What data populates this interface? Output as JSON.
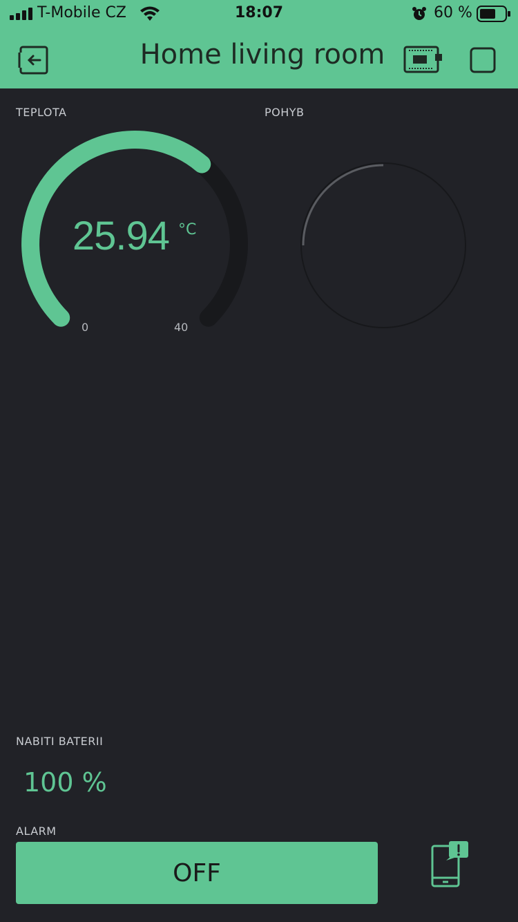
{
  "status_bar": {
    "carrier": "T-Mobile CZ",
    "time": "18:07",
    "battery_percent": "60 %",
    "icons": [
      "signal-icon",
      "wifi-icon",
      "alarm-clock-icon",
      "battery-icon"
    ]
  },
  "header": {
    "title": "Home living room",
    "left_icon": "exit-icon",
    "right_icons": [
      "device-board-icon",
      "stop-square-icon"
    ]
  },
  "teplota": {
    "label": "TEPLOTA",
    "value": "25.94",
    "unit": "°C",
    "min": "0",
    "max": "40",
    "fill_fraction": 0.6485
  },
  "pohyb": {
    "label": "POHYB"
  },
  "battery": {
    "label": "NABITI BATERII",
    "value": "100 %"
  },
  "alarm": {
    "label": "ALARM",
    "button_label": "OFF"
  },
  "notification_icon": "phone-alert-icon",
  "colors": {
    "accent": "#5fc593",
    "background": "#212227",
    "track": "#18191c"
  }
}
